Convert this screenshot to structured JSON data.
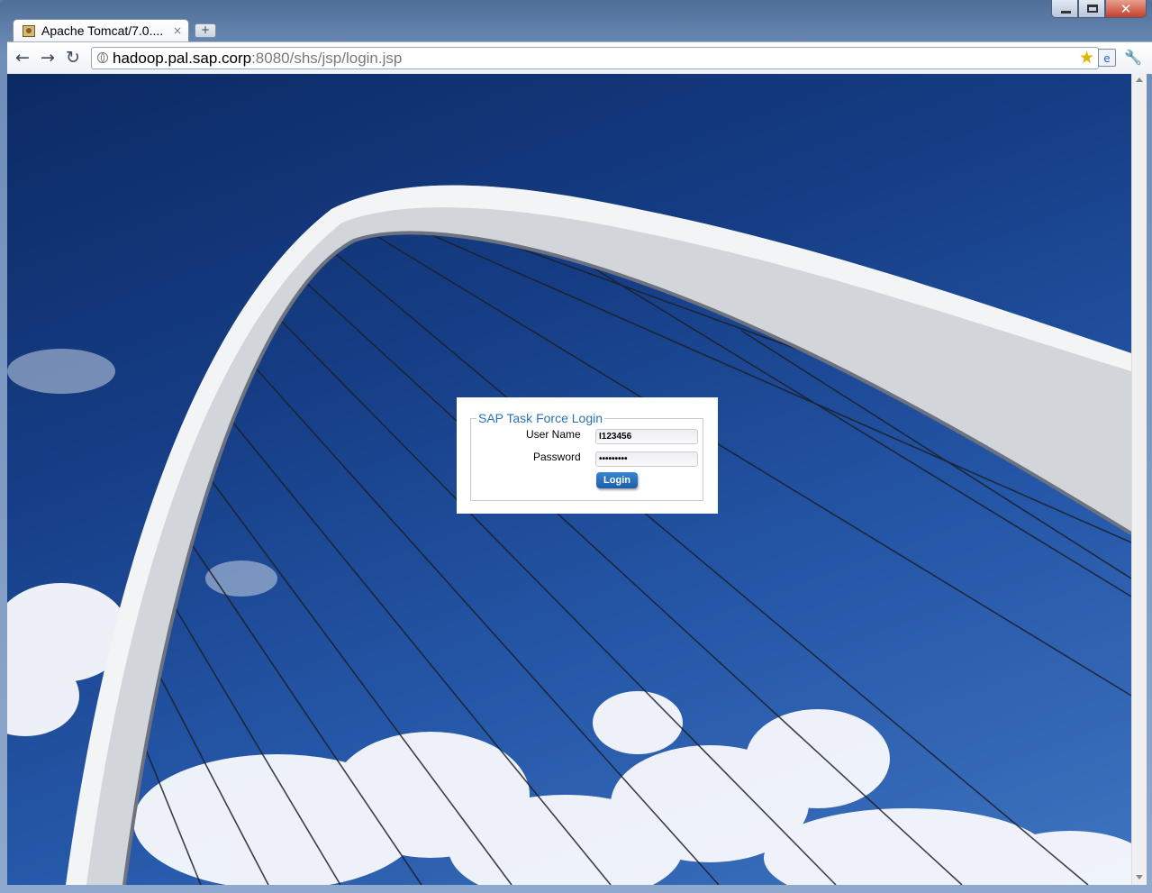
{
  "window": {
    "controls": {
      "minimize": "minimize",
      "maximize": "maximize",
      "close": "✕"
    }
  },
  "tab": {
    "title": "Apache Tomcat/7.0....",
    "close": "×",
    "new_tab": "+"
  },
  "toolbar": {
    "back": "←",
    "forward": "→",
    "reload": "↻",
    "url_host": "hadoop.pal.sap.corp",
    "url_rest": ":8080/shs/jsp/login.jsp",
    "bookmark_star": "★",
    "page_icon": "e",
    "wrench": "🔧"
  },
  "login": {
    "legend": "SAP Task Force Login",
    "username_label": "User Name",
    "username_value": "I123456",
    "password_label": "Password",
    "password_value": "•••••••••",
    "login_button": "Login"
  },
  "colors": {
    "sky_top": "#0c2a64",
    "sky_bottom": "#3e74c0",
    "legend_blue": "#2a72b8",
    "button_blue": "#1a5ea8"
  }
}
